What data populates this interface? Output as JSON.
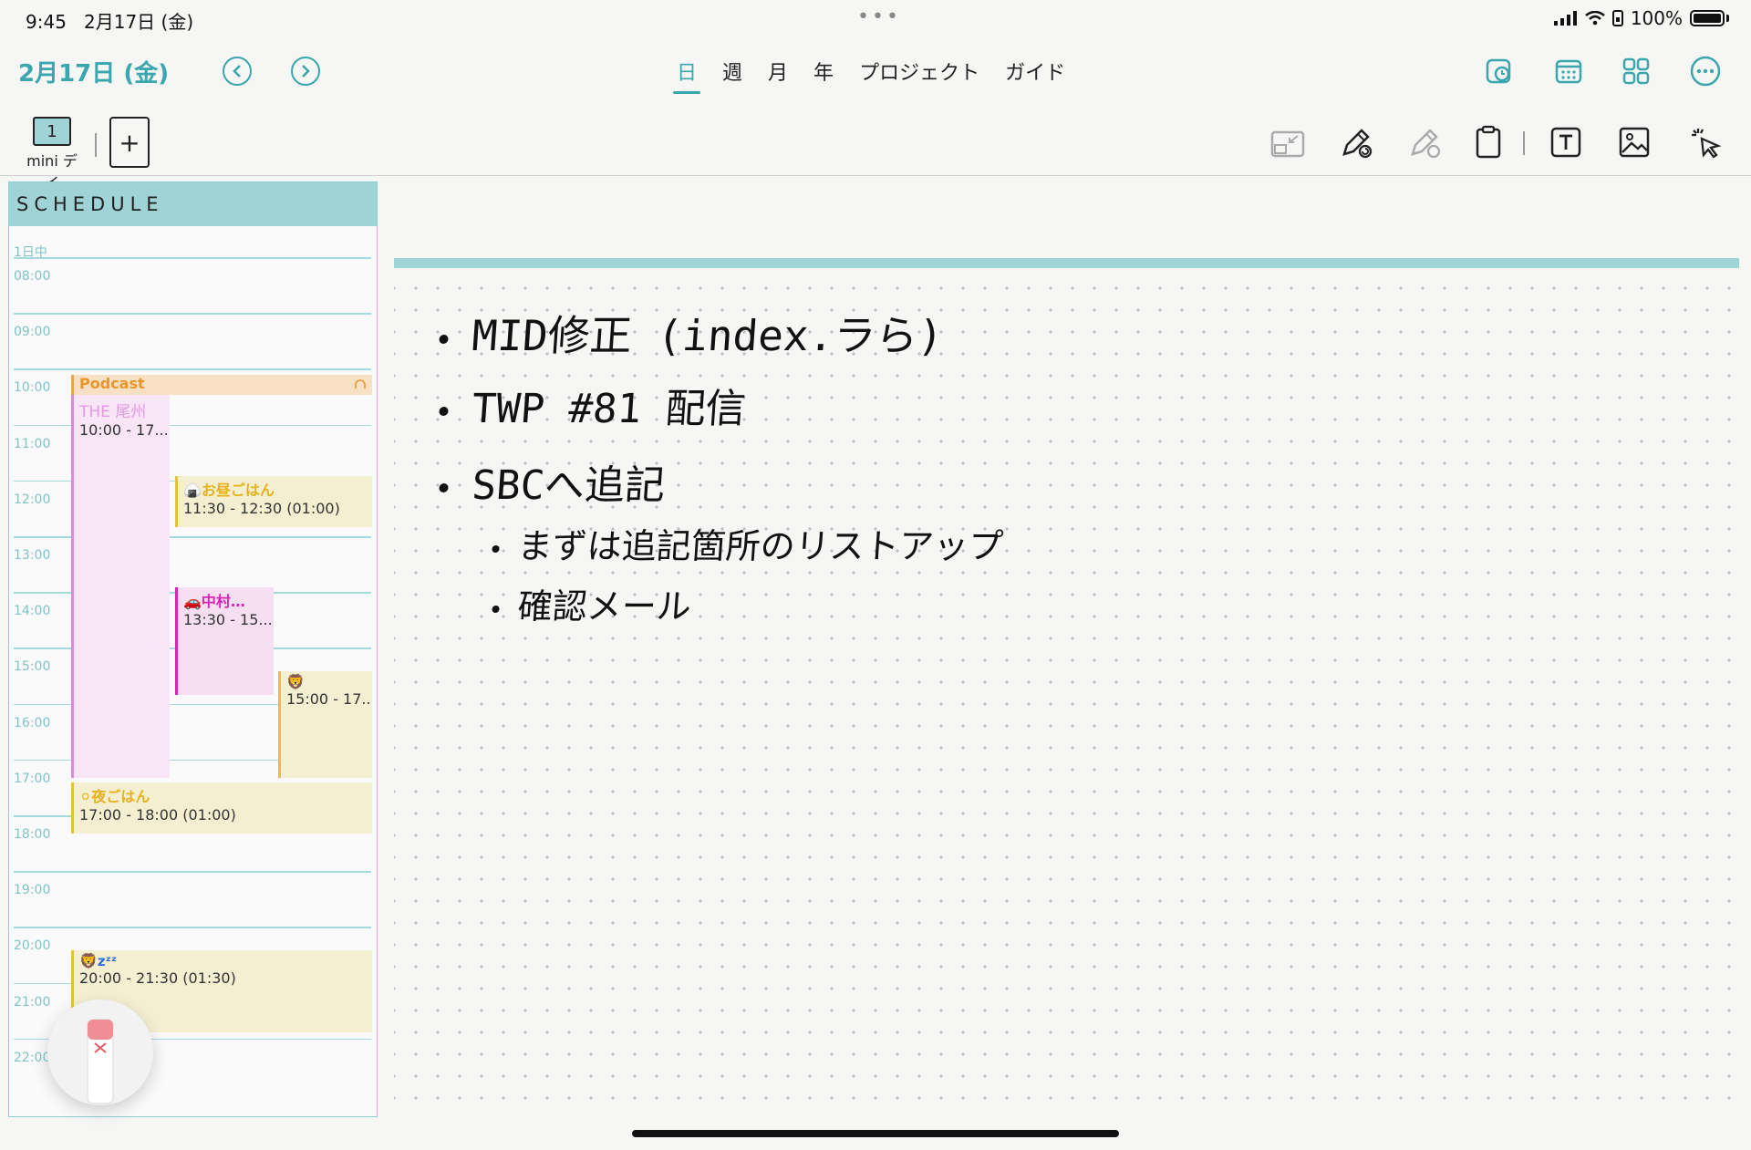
{
  "status": {
    "time": "9:45",
    "date": "2月17日 (金)",
    "battery": "100%"
  },
  "header": {
    "title": "2月17日 (金)",
    "prev_icon": "chevron-left-icon",
    "next_icon": "chevron-right-icon"
  },
  "tabs": [
    {
      "label": "日",
      "active": true
    },
    {
      "label": "週",
      "active": false
    },
    {
      "label": "月",
      "active": false
    },
    {
      "label": "年",
      "active": false
    },
    {
      "label": "プロジェクト",
      "active": false
    },
    {
      "label": "ガイド",
      "active": false
    }
  ],
  "toolbar": {
    "mini_page_number": "1",
    "mini_page_label": "mini デイ",
    "add_label": "+"
  },
  "schedule": {
    "title": "SCHEDULE",
    "allday_label": "1日中",
    "hours": [
      "08:00",
      "09:00",
      "10:00",
      "11:00",
      "12:00",
      "13:00",
      "14:00",
      "15:00",
      "16:00",
      "17:00",
      "18:00",
      "19:00",
      "20:00",
      "21:00",
      "22:00"
    ],
    "events": {
      "podcast": {
        "title": "Podcast"
      },
      "owari": {
        "title": "THE 尾州",
        "time": "10:00 - 17..."
      },
      "lunch": {
        "emoji": "🍙",
        "title": "お昼ごはん",
        "time": "11:30 - 12:30 (01:00)"
      },
      "nakamura": {
        "emoji": "🚗",
        "title": "中村…",
        "time": "13:30 - 15..."
      },
      "lion": {
        "emoji": "🦁",
        "time": "15:00 - 17..."
      },
      "dinner": {
        "emoji": "⚪",
        "title": "夜ごはん",
        "time": "17:00 - 18:00 (01:00)"
      },
      "sleep": {
        "emoji": "🦁",
        "zz": "zᶻᶻ",
        "time": "20:00 - 21:30 (01:30)"
      }
    }
  },
  "notes": [
    {
      "text": "MID修正 (index.ラら)",
      "level": 1
    },
    {
      "text": "TWP #81 配信",
      "level": 1
    },
    {
      "text": "SBCへ追記",
      "level": 1
    },
    {
      "text": "まずは追記箇所のリストアップ",
      "level": 2
    },
    {
      "text": "確認メール",
      "level": 2
    }
  ],
  "colors": {
    "accent": "#3aa6ad",
    "header_band": "#9fd3d6",
    "pink": "#d98ad9",
    "yellow": "#f5efd2",
    "orange": "#f1a34a"
  }
}
